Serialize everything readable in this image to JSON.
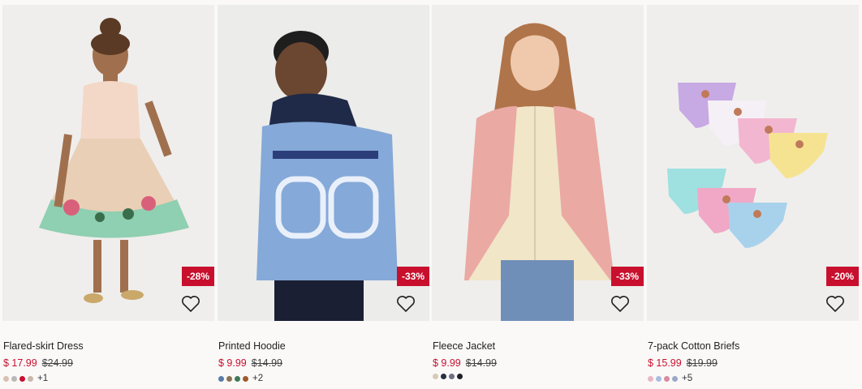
{
  "products": [
    {
      "name": "Flared-skirt Dress",
      "sale_price": "$ 17.99",
      "original_price": "$24.99",
      "discount": "-28%",
      "image_icon": "girl-in-floral-dress-photo",
      "swatches": [
        "#d8bfb0",
        "#b8b8b8",
        "#c8102e",
        "#c9b8a8"
      ],
      "more_colors": "+1"
    },
    {
      "name": "Printed Hoodie",
      "sale_price": "$ 9.99",
      "original_price": "$14.99",
      "discount": "-33%",
      "image_icon": "boy-in-blue-hoodie-photo",
      "swatches": [
        "#5a7ba8",
        "#8a7355",
        "#3e7a56",
        "#a05a2c"
      ],
      "more_colors": "+2"
    },
    {
      "name": "Fleece Jacket",
      "sale_price": "$ 9.99",
      "original_price": "$14.99",
      "discount": "-33%",
      "image_icon": "girl-in-fleece-jacket-photo",
      "swatches": [
        "#d8c9b4",
        "#2a2f3e",
        "#6d6f86",
        "#1f1f26"
      ],
      "more_colors": ""
    },
    {
      "name": "7-pack Cotton Briefs",
      "sale_price": "$ 15.99",
      "original_price": "$19.99",
      "discount": "-20%",
      "image_icon": "briefs-seven-pack-photo",
      "swatches": [
        "#e8b7c6",
        "#a8bde0",
        "#d88aa0",
        "#9aa8c8"
      ],
      "more_colors": "+5"
    }
  ],
  "colors": {
    "sale": "#c8102e",
    "badge_bg": "#c8102e"
  }
}
